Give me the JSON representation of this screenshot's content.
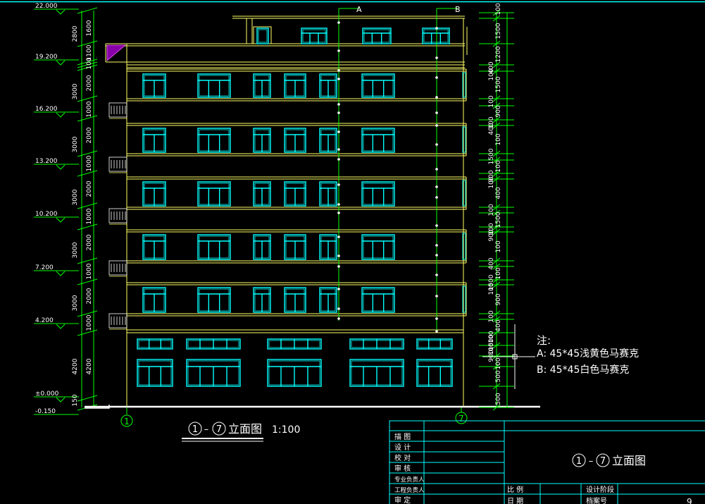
{
  "colors": {
    "background": "#000000",
    "building": "#ffff66",
    "window": "#00ffff",
    "dimension": "#00ff00",
    "text": "#ffffff",
    "titleblock": "#00ffff"
  },
  "elevations": [
    "22.000",
    "19.200",
    "16.200",
    "13.200",
    "10.200",
    "7.200",
    "4.200",
    "±0.000",
    "-0.150"
  ],
  "left_dims_outer": [
    "2800",
    "3000",
    "3000",
    "3000",
    "3000",
    "3000",
    "4200",
    "150"
  ],
  "left_dims_inner": [
    "1600",
    "1100",
    "100",
    "2000",
    "1000",
    "2000",
    "1000",
    "2000",
    "1000",
    "2000",
    "1000",
    "2000",
    "1000",
    "4200"
  ],
  "right_dims": [
    "100",
    "1500",
    "1200",
    "400",
    "100",
    "1500",
    "100",
    "900",
    "100",
    "400",
    "100",
    "1500",
    "100",
    "900",
    "100",
    "400",
    "100",
    "1500",
    "100",
    "900",
    "100",
    "400",
    "100",
    "1500",
    "100",
    "900",
    "100",
    "400",
    "100",
    "1500",
    "100",
    "900",
    "100",
    "500",
    "500",
    "600",
    "1500",
    "1000"
  ],
  "markers": {
    "a": "A",
    "b": "B",
    "axis_left": "1",
    "axis_right": "7"
  },
  "drawing": {
    "title_num_a": "1",
    "title_sep": "–",
    "title_num_b": "7",
    "title_text": "立面图",
    "scale": "1:100"
  },
  "notes": {
    "title": "注:",
    "line_a": "A: 45*45浅黄色马赛克",
    "line_b": "B: 45*45白色马赛克"
  },
  "titleblock": {
    "rows": [
      "描 图",
      "设 计",
      "校 对",
      "审 核",
      "专业负责人",
      "工程负责人",
      "审 定"
    ],
    "label_scale": "比 例",
    "label_date": "日 期",
    "label_stage": "设计阶段",
    "label_archive": "档案号",
    "title_num_a": "1",
    "title_sep": "–",
    "title_num_b": "7",
    "title_text": "立面图",
    "sheet_num": "9"
  }
}
